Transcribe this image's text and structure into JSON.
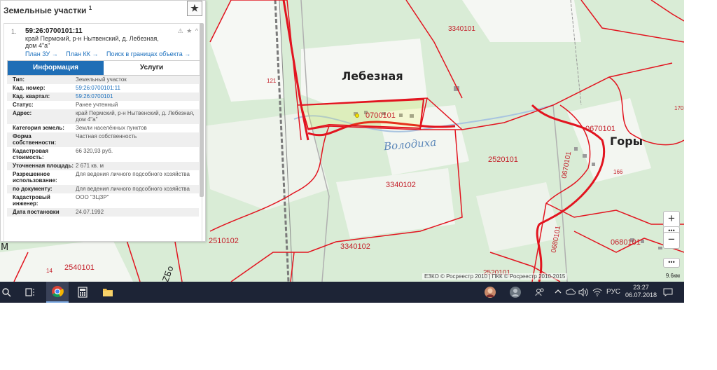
{
  "panel": {
    "title": "Земельные участки",
    "title_sup": "1",
    "star_icon": "★",
    "item_number": "1.",
    "cadastral_number": "59:26:0700101:11",
    "address": "край Пермский, р-н Нытвенский, д. Лебезная, дом 4\"а\"",
    "item_icons": "⚠ ★ ^",
    "links": [
      "План ЗУ →",
      "План КК →",
      "Поиск в границах объекта →"
    ],
    "tabs": [
      "Информация",
      "Услуги"
    ],
    "rows": [
      {
        "k": "Тип:",
        "v": "Земельный участок"
      },
      {
        "k": "Кад. номер:",
        "v": "59:26:0700101:11"
      },
      {
        "k": "Кад. квартал:",
        "v": "59:26:0700101"
      },
      {
        "k": "Статус:",
        "v": "Ранее учтенный"
      },
      {
        "k": "Адрес:",
        "v": "край Пермский, р-н Нытвенский, д. Лебезная, дом 4\"а\""
      },
      {
        "k": "Категория земель:",
        "v": "Земли населённых пунктов"
      },
      {
        "k": "Форма собственности:",
        "v": "Частная собственность"
      },
      {
        "k": "Кадастровая стоимость:",
        "v": "66 320,93 руб."
      },
      {
        "k": "Уточненная площадь:",
        "v": "2 671 кв. м"
      },
      {
        "k": "Разрешенное использование:",
        "v": "Для ведения личного подсобного хозяйства"
      },
      {
        "k": "по документу:",
        "v": "Для ведения личного подсобного хозяйства"
      },
      {
        "k": "Кадастровый инженер:",
        "v": "ООО \"ЗЦЗР\""
      },
      {
        "k": "Дата постановки",
        "v": "24.07.1992"
      }
    ]
  },
  "map": {
    "places": [
      "Лебезная",
      "Горы",
      "Володиха"
    ],
    "parcel_labels": [
      "3340101",
      "121",
      "0700101",
      "0670101",
      "170",
      "0670101",
      "2520101",
      "166",
      "3340102",
      "2510102",
      "3340102",
      "2540101",
      "14",
      "0680101",
      "0680101",
      "2520101"
    ],
    "edge_letters": [
      "М",
      "ZБо"
    ],
    "copyright": "ЕЗКО © Росреестр 2010 | ПКК © Росреестр 2010-2015",
    "scale": "9.6км",
    "zoom_in": "+",
    "zoom_out": "−",
    "zoom_dots": "•••"
  },
  "taskbar": {
    "lang": "РУС",
    "time": "23:27",
    "date": "06.07.2018",
    "icons": [
      "search-icon",
      "task-view-icon",
      "chrome-icon",
      "calculator-icon",
      "file-explorer-icon"
    ]
  },
  "colors": {
    "boundary": "#e2141f",
    "taskbar": "#1d2436",
    "tab_active": "#1f6eb6"
  }
}
